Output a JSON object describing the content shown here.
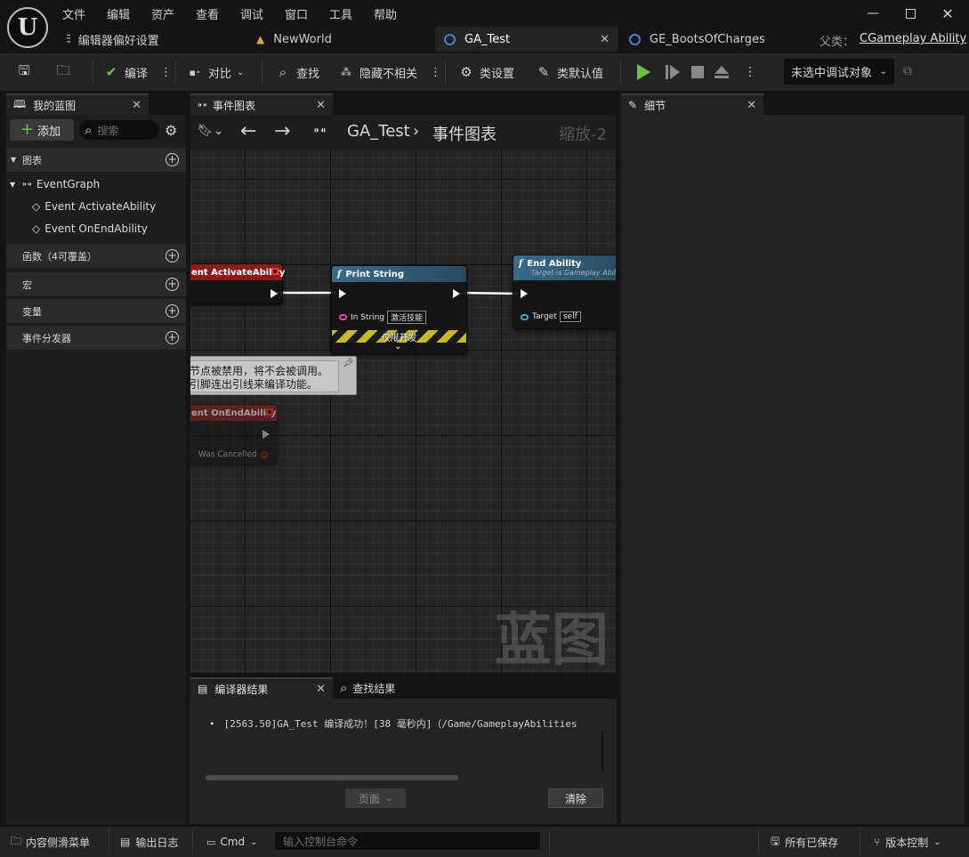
{
  "menu": [
    "文件",
    "编辑",
    "资产",
    "查看",
    "调试",
    "窗口",
    "工具",
    "帮助"
  ],
  "doc_tabs": {
    "prefs": "编辑器偏好设置",
    "world": "NewWorld",
    "active": "GA_Test",
    "other": "GE_BootsOfCharges"
  },
  "parent": {
    "label": "父类：",
    "value": "CGameplay Ability"
  },
  "toolbar": {
    "compile": "编译",
    "diff": "对比",
    "find": "查找",
    "hide_unrelated": "隐藏不相关",
    "class_settings": "类设置",
    "class_defaults": "类默认值",
    "debug_target": "未选中调试对象"
  },
  "my_blueprint": {
    "tab": "我的蓝图",
    "add": "添加",
    "search_placeholder": "搜索",
    "graphs": "图表",
    "event_graph": "EventGraph",
    "events": [
      "Event ActivateAbility",
      "Event OnEndAbility"
    ],
    "functions": "函数（4可覆盖）",
    "macros": "宏",
    "variables": "变量",
    "dispatchers": "事件分发器"
  },
  "graph_tab": "事件图表",
  "breadcrumb": {
    "asset": "GA_Test",
    "graph": "事件图表",
    "zoom": "缩放-2"
  },
  "nodes": {
    "activate": "ent ActivateAbility",
    "print_title": "Print String",
    "in_string_label": "In String",
    "in_string_value": "激活技能",
    "dev_only": "仅限开发",
    "end_title": "End Ability",
    "end_subtitle": "Target is Gameplay Abili",
    "target_label": "Target",
    "target_value": "self",
    "on_end": "ent OnEndAbility",
    "was_cancelled": "Was Cancelled",
    "disabled_comment_1": "节点被禁用，将不会被调用。",
    "disabled_comment_2": "引脚连出引线来编译功能。"
  },
  "watermark": "蓝图",
  "details_tab": "细节",
  "compiler": {
    "tab": "编译器结果",
    "find_tab": "查找结果",
    "message": "[2563.50]GA_Test 编译成功！[38 毫秒内]（/Game/GameplayAbilities",
    "page": "页面",
    "clear": "清除"
  },
  "status": {
    "content_drawer": "内容侧滑菜单",
    "output_log": "输出日志",
    "cmd": "Cmd",
    "console_placeholder": "输入控制台命令",
    "saved": "所有已保存",
    "source_control": "版本控制"
  },
  "colors": {
    "event_head": "#8b1c1c",
    "function_head": "#3a6a8a",
    "play": "#6cc04a",
    "exec_wire": "#ffffff"
  }
}
